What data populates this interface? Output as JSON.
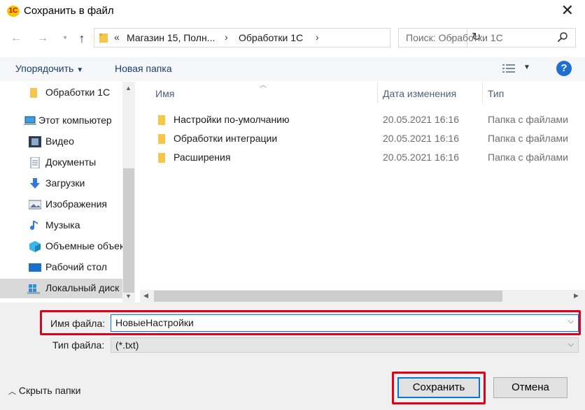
{
  "window": {
    "title": "Сохранить в файл",
    "app_icon_text": "1С"
  },
  "address": {
    "overflow": "«",
    "segments": [
      "Магазин 15, Полн...",
      "Обработки 1С"
    ]
  },
  "search": {
    "placeholder": "Поиск: Обработки 1С"
  },
  "toolbar": {
    "organize_label": "Упорядочить",
    "new_folder_label": "Новая папка",
    "help_label": "?"
  },
  "nav": {
    "items": [
      {
        "label": "Обработки 1С",
        "icon": "folder-icon"
      },
      {
        "label": "Этот компьютер",
        "icon": "computer-icon"
      },
      {
        "label": "Видео",
        "icon": "video-icon"
      },
      {
        "label": "Документы",
        "icon": "documents-icon"
      },
      {
        "label": "Загрузки",
        "icon": "downloads-icon"
      },
      {
        "label": "Изображения",
        "icon": "pictures-icon"
      },
      {
        "label": "Музыка",
        "icon": "music-icon"
      },
      {
        "label": "Объемные объекты",
        "icon": "3d-objects-icon"
      },
      {
        "label": "Рабочий стол",
        "icon": "desktop-icon"
      },
      {
        "label": "Локальный диск",
        "icon": "local-disk-icon"
      }
    ]
  },
  "columns": {
    "name": "Имя",
    "date": "Дата изменения",
    "type": "Тип"
  },
  "files": [
    {
      "name": "Настройки по-умолчанию",
      "date": "20.05.2021 16:16",
      "type": "Папка с файлами"
    },
    {
      "name": "Обработки интеграции",
      "date": "20.05.2021 16:16",
      "type": "Папка с файлами"
    },
    {
      "name": "Расширения",
      "date": "20.05.2021 16:16",
      "type": "Папка с файлами"
    }
  ],
  "form": {
    "filename_label": "Имя файла:",
    "filename_value": "НовыеНастройки",
    "filetype_label": "Тип файла:",
    "filetype_value": "(*.txt)"
  },
  "buttons": {
    "save": "Сохранить",
    "cancel": "Отмена",
    "hide_folders": "Скрыть папки"
  },
  "colors": {
    "highlight": "#e0001a",
    "focus": "#0078d7",
    "help": "#1f6fd0"
  }
}
